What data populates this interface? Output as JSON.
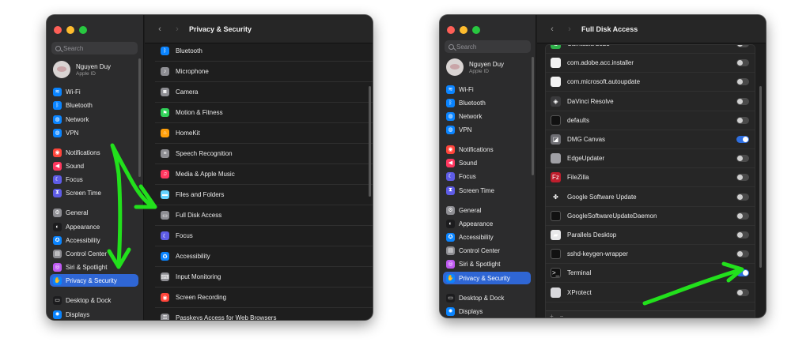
{
  "left_window": {
    "title": "Privacy & Security",
    "search_placeholder": "Search",
    "profile": {
      "name": "Nguyen Duy",
      "subtitle": "Apple ID"
    },
    "sidebar": [
      {
        "label": "Wi-Fi",
        "icon": "wifi-icon",
        "color": "#0a84ff",
        "glyph": "≋"
      },
      {
        "label": "Bluetooth",
        "icon": "bluetooth-icon",
        "color": "#0a84ff",
        "glyph": "ᛒ"
      },
      {
        "label": "Network",
        "icon": "globe-icon",
        "color": "#0a84ff",
        "glyph": "◍"
      },
      {
        "label": "VPN",
        "icon": "vpn-globe-icon",
        "color": "#0a84ff",
        "glyph": "◍"
      },
      {
        "label": "Notifications",
        "icon": "bell-icon",
        "color": "#ff453a",
        "glyph": "◉"
      },
      {
        "label": "Sound",
        "icon": "speaker-icon",
        "color": "#ff375f",
        "glyph": "◀"
      },
      {
        "label": "Focus",
        "icon": "moon-icon",
        "color": "#5e5ce6",
        "glyph": "☾"
      },
      {
        "label": "Screen Time",
        "icon": "hourglass-icon",
        "color": "#5e5ce6",
        "glyph": "⧗"
      },
      {
        "label": "General",
        "icon": "gear-icon",
        "color": "#8e8e93",
        "glyph": "⚙"
      },
      {
        "label": "Appearance",
        "icon": "appearance-icon",
        "color": "#1c1c1e",
        "glyph": "◐"
      },
      {
        "label": "Accessibility",
        "icon": "accessibility-icon",
        "color": "#0a84ff",
        "glyph": "✪"
      },
      {
        "label": "Control Center",
        "icon": "control-center-icon",
        "color": "#8e8e93",
        "glyph": "▤"
      },
      {
        "label": "Siri & Spotlight",
        "icon": "siri-icon",
        "color": "#bf5af2",
        "glyph": "◎"
      },
      {
        "label": "Privacy & Security",
        "icon": "hand-icon",
        "color": "#0a84ff",
        "glyph": "✋",
        "active": true
      },
      {
        "label": "Desktop & Dock",
        "icon": "dock-icon",
        "color": "#1c1c1e",
        "glyph": "▭"
      },
      {
        "label": "Displays",
        "icon": "sun-icon",
        "color": "#0a84ff",
        "glyph": "✹"
      }
    ],
    "rows": [
      {
        "label": "Bluetooth",
        "icon": "bluetooth-icon",
        "color": "#0a84ff",
        "glyph": "ᛒ"
      },
      {
        "label": "Microphone",
        "icon": "microphone-icon",
        "color": "#8e8e93",
        "glyph": "♪"
      },
      {
        "label": "Camera",
        "icon": "camera-icon",
        "color": "#8e8e93",
        "glyph": "◙"
      },
      {
        "label": "Motion & Fitness",
        "icon": "fitness-icon",
        "color": "#30d158",
        "glyph": "⚑"
      },
      {
        "label": "HomeKit",
        "icon": "home-icon",
        "color": "#ff9f0a",
        "glyph": "⌂"
      },
      {
        "label": "Speech Recognition",
        "icon": "waveform-icon",
        "color": "#8e8e93",
        "glyph": "≡"
      },
      {
        "label": "Media & Apple Music",
        "icon": "music-icon",
        "color": "#ff375f",
        "glyph": "♫"
      },
      {
        "label": "Files and Folders",
        "icon": "folder-icon",
        "color": "#64d2ff",
        "glyph": "▬"
      },
      {
        "label": "Full Disk Access",
        "icon": "disk-icon",
        "color": "#8e8e93",
        "glyph": "▭"
      },
      {
        "label": "Focus",
        "icon": "moon-icon",
        "color": "#5e5ce6",
        "glyph": "☾"
      },
      {
        "label": "Accessibility",
        "icon": "accessibility-icon",
        "color": "#0a84ff",
        "glyph": "✪"
      },
      {
        "label": "Input Monitoring",
        "icon": "keyboard-icon",
        "color": "#8e8e93",
        "glyph": "⌨"
      },
      {
        "label": "Screen Recording",
        "icon": "record-icon",
        "color": "#ff453a",
        "glyph": "◉"
      },
      {
        "label": "Passkeys Access for Web Browsers",
        "icon": "passkey-icon",
        "color": "#8e8e93",
        "glyph": "⚿"
      }
    ]
  },
  "right_window": {
    "title": "Full Disk Access",
    "search_placeholder": "Search",
    "profile": {
      "name": "Nguyen Duy",
      "subtitle": "Apple ID"
    },
    "sidebar": [
      {
        "label": "Wi-Fi",
        "icon": "wifi-icon",
        "color": "#0a84ff",
        "glyph": "≋"
      },
      {
        "label": "Bluetooth",
        "icon": "bluetooth-icon",
        "color": "#0a84ff",
        "glyph": "ᛒ"
      },
      {
        "label": "Network",
        "icon": "globe-icon",
        "color": "#0a84ff",
        "glyph": "◍"
      },
      {
        "label": "VPN",
        "icon": "vpn-globe-icon",
        "color": "#0a84ff",
        "glyph": "◍"
      },
      {
        "label": "Notifications",
        "icon": "bell-icon",
        "color": "#ff453a",
        "glyph": "◉"
      },
      {
        "label": "Sound",
        "icon": "speaker-icon",
        "color": "#ff375f",
        "glyph": "◀"
      },
      {
        "label": "Focus",
        "icon": "moon-icon",
        "color": "#5e5ce6",
        "glyph": "☾"
      },
      {
        "label": "Screen Time",
        "icon": "hourglass-icon",
        "color": "#5e5ce6",
        "glyph": "⧗"
      },
      {
        "label": "General",
        "icon": "gear-icon",
        "color": "#8e8e93",
        "glyph": "⚙"
      },
      {
        "label": "Appearance",
        "icon": "appearance-icon",
        "color": "#1c1c1e",
        "glyph": "◐"
      },
      {
        "label": "Accessibility",
        "icon": "accessibility-icon",
        "color": "#0a84ff",
        "glyph": "✪"
      },
      {
        "label": "Control Center",
        "icon": "control-center-icon",
        "color": "#8e8e93",
        "glyph": "▤"
      },
      {
        "label": "Siri & Spotlight",
        "icon": "siri-icon",
        "color": "#bf5af2",
        "glyph": "◎"
      },
      {
        "label": "Privacy & Security",
        "icon": "hand-icon",
        "color": "#0a84ff",
        "glyph": "✋",
        "active": true
      },
      {
        "label": "Desktop & Dock",
        "icon": "dock-icon",
        "color": "#1c1c1e",
        "glyph": "▭"
      },
      {
        "label": "Displays",
        "icon": "sun-icon",
        "color": "#0a84ff",
        "glyph": "✹"
      }
    ],
    "apps": [
      {
        "label": "Camtasia 2023",
        "icon": "camtasia-icon",
        "color": "#2fb14a",
        "glyph": "C",
        "enabled": false
      },
      {
        "label": "com.adobe.acc.installer",
        "icon": "document-icon",
        "color": "#f2f2f2",
        "glyph": "",
        "enabled": false
      },
      {
        "label": "com.microsoft.autoupdate",
        "icon": "document-icon",
        "color": "#f2f2f2",
        "glyph": "",
        "enabled": false
      },
      {
        "label": "DaVinci Resolve",
        "icon": "davinci-icon",
        "color": "#3a3a3c",
        "glyph": "◈",
        "enabled": false
      },
      {
        "label": "defaults",
        "icon": "terminal-exec-icon",
        "color": "#111111",
        "glyph": "",
        "enabled": false
      },
      {
        "label": "DMG Canvas",
        "icon": "dmg-canvas-icon",
        "color": "#6e6e73",
        "glyph": "◪",
        "enabled": true
      },
      {
        "label": "EdgeUpdater",
        "icon": "app-generic-icon",
        "color": "#a0a0a5",
        "glyph": "",
        "enabled": false
      },
      {
        "label": "FileZilla",
        "icon": "filezilla-icon",
        "color": "#bf1e2d",
        "glyph": "Fz",
        "enabled": false
      },
      {
        "label": "Google Software Update",
        "icon": "google-update-icon",
        "color": "#262626",
        "glyph": "✤",
        "enabled": false
      },
      {
        "label": "GoogleSoftwareUpdateDaemon",
        "icon": "terminal-exec-icon",
        "color": "#111111",
        "glyph": "",
        "enabled": false
      },
      {
        "label": "Parallels Desktop",
        "icon": "parallels-icon",
        "color": "#e8e8ea",
        "glyph": "▰",
        "enabled": false
      },
      {
        "label": "sshd-keygen-wrapper",
        "icon": "terminal-exec-icon",
        "color": "#111111",
        "glyph": "",
        "enabled": false
      },
      {
        "label": "Terminal",
        "icon": "terminal-icon",
        "color": "#111111",
        "glyph": ">_",
        "enabled": true
      },
      {
        "label": "XProtect",
        "icon": "app-generic-icon",
        "color": "#d8d8dc",
        "glyph": "",
        "enabled": false
      }
    ],
    "footer": {
      "add": "+",
      "remove": "−"
    }
  },
  "colors": {
    "annotation": "#22e01c",
    "accent": "#2f66d4"
  }
}
